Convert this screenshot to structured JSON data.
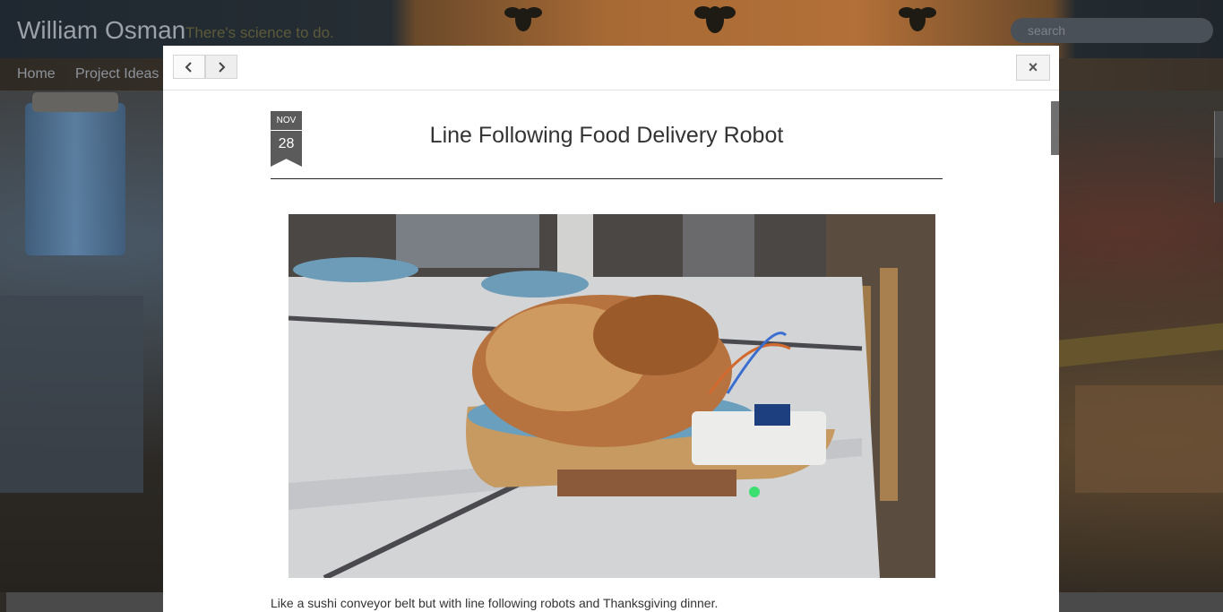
{
  "site": {
    "title": "William Osman",
    "tagline": "There's science to do.",
    "search_placeholder": "search",
    "nav": [
      "Home",
      "Project Ideas"
    ]
  },
  "modal": {
    "prev_icon": "chevron-left-icon",
    "next_icon": "chevron-right-icon",
    "close_label": "×",
    "post": {
      "date_month": "NOV",
      "date_day": "28",
      "title": "Line Following Food Delivery Robot",
      "image_alt": "Roast chicken on a plate riding on a wooden line-following robot with breadboard and Arduino",
      "excerpt": "Like a sushi conveyor belt but with line following robots and Thanksgiving dinner."
    }
  },
  "colors": {
    "modal_bg": "#ffffff",
    "badge_bg": "#5b5b5b",
    "title_text": "#333333"
  }
}
